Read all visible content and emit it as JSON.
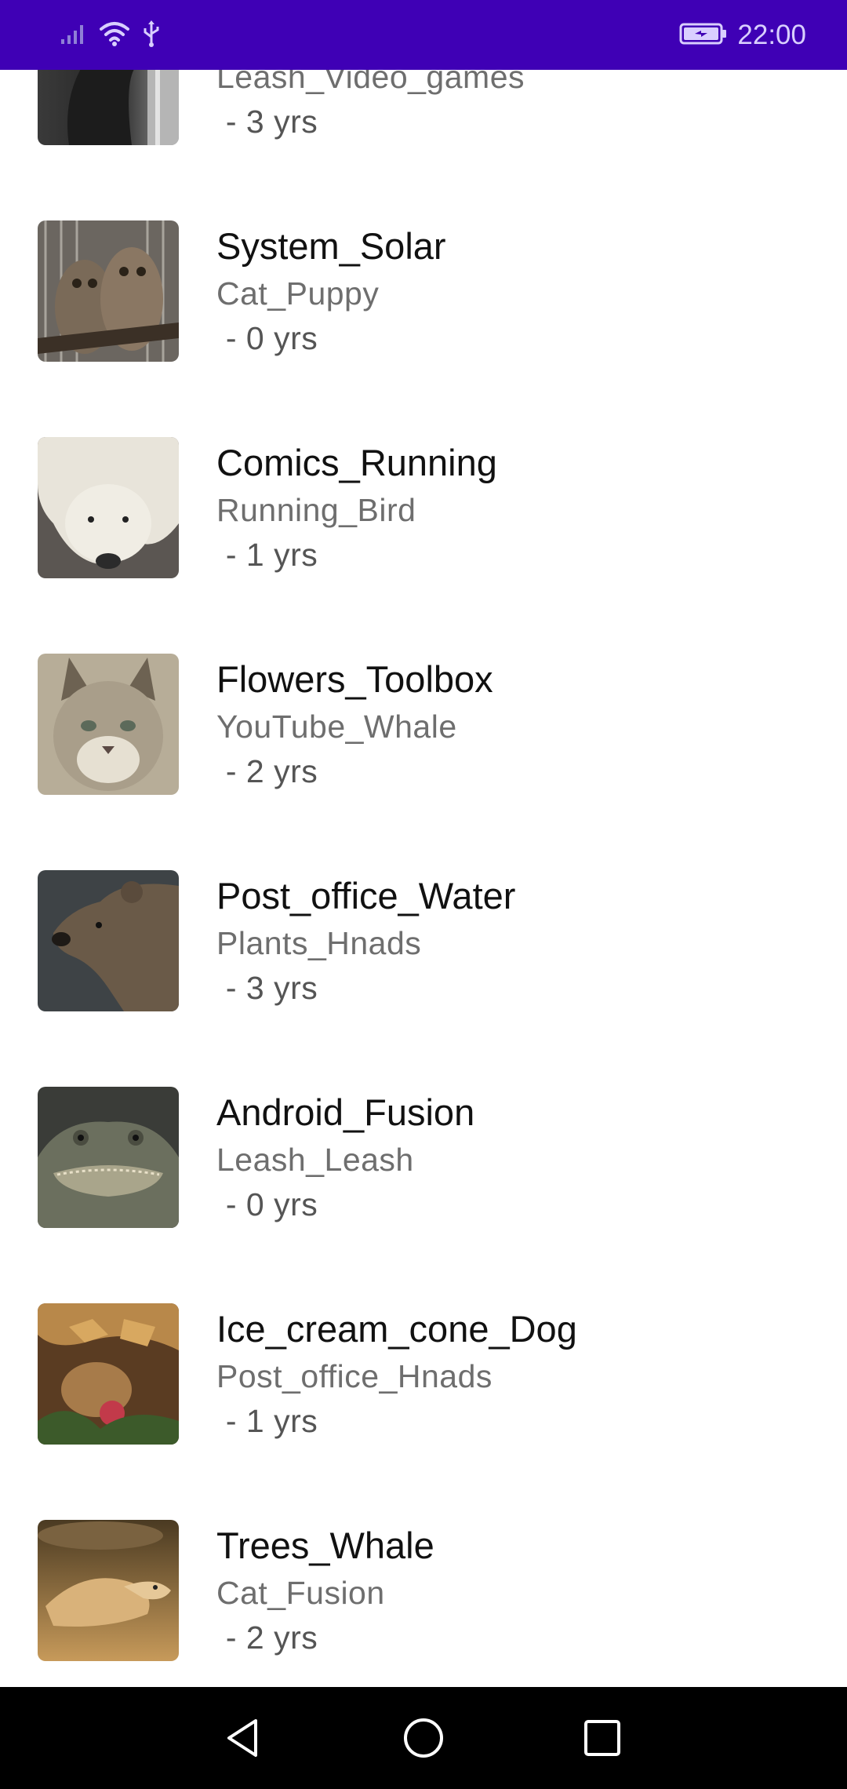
{
  "status_bar": {
    "time": "22:00",
    "icons": [
      "signal-icon",
      "wifi-icon",
      "usb-icon",
      "battery-charging-icon"
    ]
  },
  "list": {
    "items": [
      {
        "title": "",
        "subtitle": "Leash_Video_games",
        "age": " - 3 yrs",
        "image": "eagle"
      },
      {
        "title": "System_Solar",
        "subtitle": "Cat_Puppy",
        "age": " - 0 yrs",
        "image": "owls"
      },
      {
        "title": "Comics_Running",
        "subtitle": "Running_Bird",
        "age": " - 1 yrs",
        "image": "polar-bear"
      },
      {
        "title": "Flowers_Toolbox",
        "subtitle": "YouTube_Whale",
        "age": " - 2 yrs",
        "image": "lynx"
      },
      {
        "title": "Post_office_Water",
        "subtitle": "Plants_Hnads",
        "age": " - 3 yrs",
        "image": "brown-bear"
      },
      {
        "title": "Android_Fusion",
        "subtitle": "Leash_Leash",
        "age": " - 0 yrs",
        "image": "alligator"
      },
      {
        "title": "Ice_cream_cone_Dog",
        "subtitle": "Post_office_Hnads",
        "age": " - 1 yrs",
        "image": "tortoise"
      },
      {
        "title": "Trees_Whale",
        "subtitle": "Cat_Fusion",
        "age": " - 2 yrs",
        "image": "turtle"
      }
    ]
  },
  "nav_bar": {
    "buttons": [
      "back-icon",
      "home-icon",
      "recents-icon"
    ]
  },
  "colors": {
    "status_bar": "#3f00b5",
    "nav_bar": "#000000",
    "title_text": "#111111",
    "secondary_text": "#6e6e6e"
  }
}
